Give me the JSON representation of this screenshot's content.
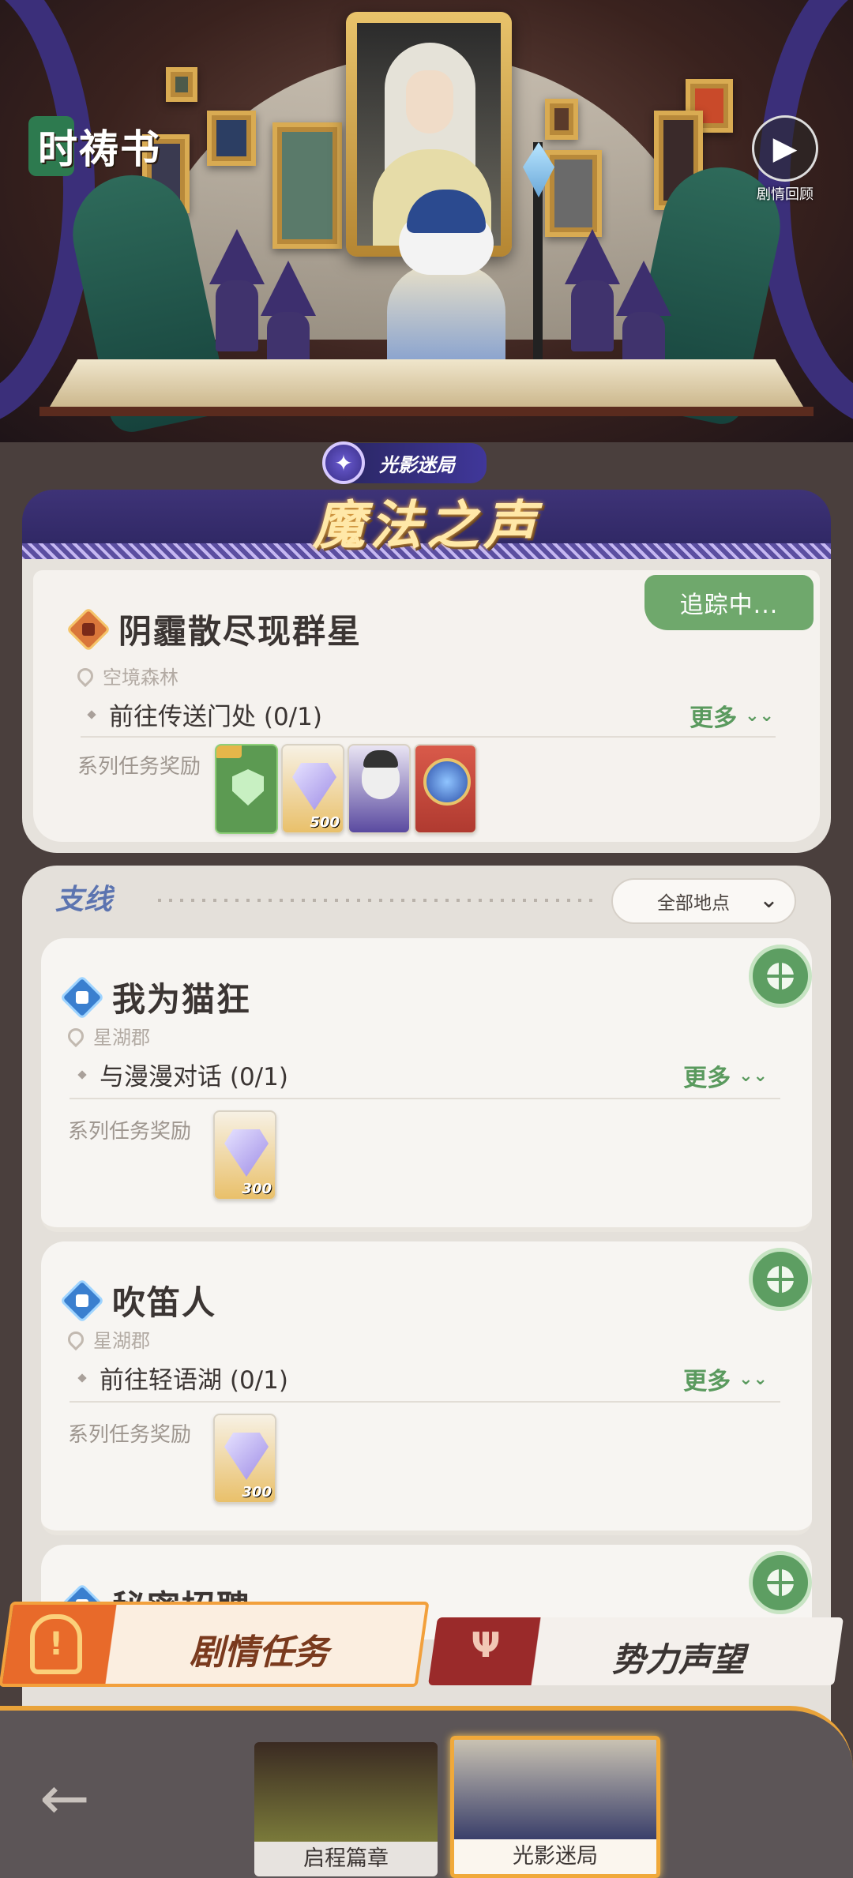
{
  "header": {
    "logo_text": "时祷书",
    "replay_label": "剧情回顾"
  },
  "banner_title": {
    "subtitle": "光影迷局",
    "title": "魔法之声"
  },
  "main_quest": {
    "title": "阴霾散尽现群星",
    "location": "空境森林",
    "step": "前往传送门处 (0/1)",
    "more_label": "更多",
    "tracking_label": "追踪中...",
    "reward_label": "系列任务奖励",
    "rewards": [
      {
        "kind": "card",
        "qty": ""
      },
      {
        "kind": "gem",
        "qty": "500"
      },
      {
        "kind": "avatar",
        "qty": ""
      },
      {
        "kind": "globe",
        "qty": ""
      }
    ]
  },
  "side_quests": {
    "header": "支线",
    "filter_label": "全部地点",
    "items": [
      {
        "title": "我为猫狂",
        "location": "星湖郡",
        "step": "与漫漫对话 (0/1)",
        "more_label": "更多",
        "reward_label": "系列任务奖励",
        "reward_qty": "300"
      },
      {
        "title": "吹笛人",
        "location": "星湖郡",
        "step": "前往轻语湖 (0/1)",
        "more_label": "更多",
        "reward_label": "系列任务奖励",
        "reward_qty": "300"
      },
      {
        "title": "秘密招聘",
        "location": "",
        "step": "",
        "more_label": "",
        "reward_label": "",
        "reward_qty": ""
      }
    ]
  },
  "tabs": {
    "plot": "剧情任务",
    "faction": "势力声望"
  },
  "chapters": [
    {
      "label": "启程篇章",
      "active": false
    },
    {
      "label": "光影迷局",
      "active": true
    }
  ],
  "icons": {
    "back": "back-arrow-icon",
    "replay": "replay-icon",
    "track": "track-target-icon"
  },
  "colors": {
    "accent_green": "#6fa86c",
    "accent_orange": "#e86a2a",
    "title_gold": "#ffe8a8",
    "side_label_blue": "#5c74b0"
  }
}
